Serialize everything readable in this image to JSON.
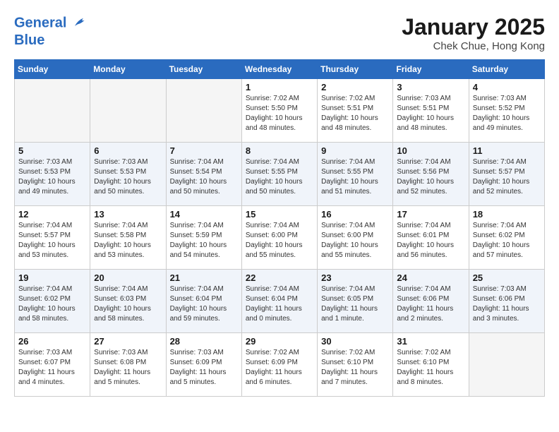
{
  "header": {
    "logo_line1": "General",
    "logo_line2": "Blue",
    "month": "January 2025",
    "location": "Chek Chue, Hong Kong"
  },
  "weekdays": [
    "Sunday",
    "Monday",
    "Tuesday",
    "Wednesday",
    "Thursday",
    "Friday",
    "Saturday"
  ],
  "weeks": [
    [
      {
        "day": "",
        "info": ""
      },
      {
        "day": "",
        "info": ""
      },
      {
        "day": "",
        "info": ""
      },
      {
        "day": "1",
        "info": "Sunrise: 7:02 AM\nSunset: 5:50 PM\nDaylight: 10 hours\nand 48 minutes."
      },
      {
        "day": "2",
        "info": "Sunrise: 7:02 AM\nSunset: 5:51 PM\nDaylight: 10 hours\nand 48 minutes."
      },
      {
        "day": "3",
        "info": "Sunrise: 7:03 AM\nSunset: 5:51 PM\nDaylight: 10 hours\nand 48 minutes."
      },
      {
        "day": "4",
        "info": "Sunrise: 7:03 AM\nSunset: 5:52 PM\nDaylight: 10 hours\nand 49 minutes."
      }
    ],
    [
      {
        "day": "5",
        "info": "Sunrise: 7:03 AM\nSunset: 5:53 PM\nDaylight: 10 hours\nand 49 minutes."
      },
      {
        "day": "6",
        "info": "Sunrise: 7:03 AM\nSunset: 5:53 PM\nDaylight: 10 hours\nand 50 minutes."
      },
      {
        "day": "7",
        "info": "Sunrise: 7:04 AM\nSunset: 5:54 PM\nDaylight: 10 hours\nand 50 minutes."
      },
      {
        "day": "8",
        "info": "Sunrise: 7:04 AM\nSunset: 5:55 PM\nDaylight: 10 hours\nand 50 minutes."
      },
      {
        "day": "9",
        "info": "Sunrise: 7:04 AM\nSunset: 5:55 PM\nDaylight: 10 hours\nand 51 minutes."
      },
      {
        "day": "10",
        "info": "Sunrise: 7:04 AM\nSunset: 5:56 PM\nDaylight: 10 hours\nand 52 minutes."
      },
      {
        "day": "11",
        "info": "Sunrise: 7:04 AM\nSunset: 5:57 PM\nDaylight: 10 hours\nand 52 minutes."
      }
    ],
    [
      {
        "day": "12",
        "info": "Sunrise: 7:04 AM\nSunset: 5:57 PM\nDaylight: 10 hours\nand 53 minutes."
      },
      {
        "day": "13",
        "info": "Sunrise: 7:04 AM\nSunset: 5:58 PM\nDaylight: 10 hours\nand 53 minutes."
      },
      {
        "day": "14",
        "info": "Sunrise: 7:04 AM\nSunset: 5:59 PM\nDaylight: 10 hours\nand 54 minutes."
      },
      {
        "day": "15",
        "info": "Sunrise: 7:04 AM\nSunset: 6:00 PM\nDaylight: 10 hours\nand 55 minutes."
      },
      {
        "day": "16",
        "info": "Sunrise: 7:04 AM\nSunset: 6:00 PM\nDaylight: 10 hours\nand 55 minutes."
      },
      {
        "day": "17",
        "info": "Sunrise: 7:04 AM\nSunset: 6:01 PM\nDaylight: 10 hours\nand 56 minutes."
      },
      {
        "day": "18",
        "info": "Sunrise: 7:04 AM\nSunset: 6:02 PM\nDaylight: 10 hours\nand 57 minutes."
      }
    ],
    [
      {
        "day": "19",
        "info": "Sunrise: 7:04 AM\nSunset: 6:02 PM\nDaylight: 10 hours\nand 58 minutes."
      },
      {
        "day": "20",
        "info": "Sunrise: 7:04 AM\nSunset: 6:03 PM\nDaylight: 10 hours\nand 58 minutes."
      },
      {
        "day": "21",
        "info": "Sunrise: 7:04 AM\nSunset: 6:04 PM\nDaylight: 10 hours\nand 59 minutes."
      },
      {
        "day": "22",
        "info": "Sunrise: 7:04 AM\nSunset: 6:04 PM\nDaylight: 11 hours\nand 0 minutes."
      },
      {
        "day": "23",
        "info": "Sunrise: 7:04 AM\nSunset: 6:05 PM\nDaylight: 11 hours\nand 1 minute."
      },
      {
        "day": "24",
        "info": "Sunrise: 7:04 AM\nSunset: 6:06 PM\nDaylight: 11 hours\nand 2 minutes."
      },
      {
        "day": "25",
        "info": "Sunrise: 7:03 AM\nSunset: 6:06 PM\nDaylight: 11 hours\nand 3 minutes."
      }
    ],
    [
      {
        "day": "26",
        "info": "Sunrise: 7:03 AM\nSunset: 6:07 PM\nDaylight: 11 hours\nand 4 minutes."
      },
      {
        "day": "27",
        "info": "Sunrise: 7:03 AM\nSunset: 6:08 PM\nDaylight: 11 hours\nand 5 minutes."
      },
      {
        "day": "28",
        "info": "Sunrise: 7:03 AM\nSunset: 6:09 PM\nDaylight: 11 hours\nand 5 minutes."
      },
      {
        "day": "29",
        "info": "Sunrise: 7:02 AM\nSunset: 6:09 PM\nDaylight: 11 hours\nand 6 minutes."
      },
      {
        "day": "30",
        "info": "Sunrise: 7:02 AM\nSunset: 6:10 PM\nDaylight: 11 hours\nand 7 minutes."
      },
      {
        "day": "31",
        "info": "Sunrise: 7:02 AM\nSunset: 6:10 PM\nDaylight: 11 hours\nand 8 minutes."
      },
      {
        "day": "",
        "info": ""
      }
    ]
  ]
}
